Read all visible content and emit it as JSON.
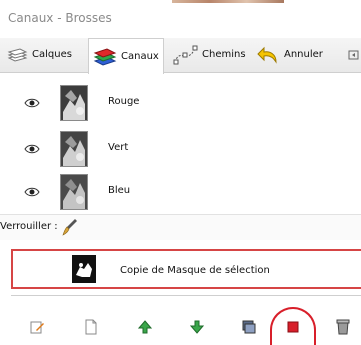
{
  "window": {
    "title": "Canaux - Brosses"
  },
  "tabs": [
    {
      "label": "Calques",
      "icon": "layers-icon"
    },
    {
      "label": "Canaux",
      "icon": "channels-icon",
      "active": true
    },
    {
      "label": "Chemins",
      "icon": "paths-icon"
    },
    {
      "label": "Annuler",
      "icon": "undo-icon"
    }
  ],
  "channels": [
    {
      "label": "Rouge",
      "visible": true
    },
    {
      "label": "Vert",
      "visible": true
    },
    {
      "label": "Bleu",
      "visible": true
    }
  ],
  "lock": {
    "label": "Verrouiller :"
  },
  "selection_channel": {
    "label": "Copie de Masque de sélection",
    "highlighted": true
  },
  "toolbar": {
    "buttons": [
      "edit-channel-icon",
      "new-channel-icon",
      "raise-channel-icon",
      "lower-channel-icon",
      "duplicate-channel-icon",
      "delete-channel-icon",
      "channel-to-selection-icon"
    ]
  },
  "colors": {
    "highlight": "#d64545",
    "arrow_green": "#3aa64a"
  }
}
